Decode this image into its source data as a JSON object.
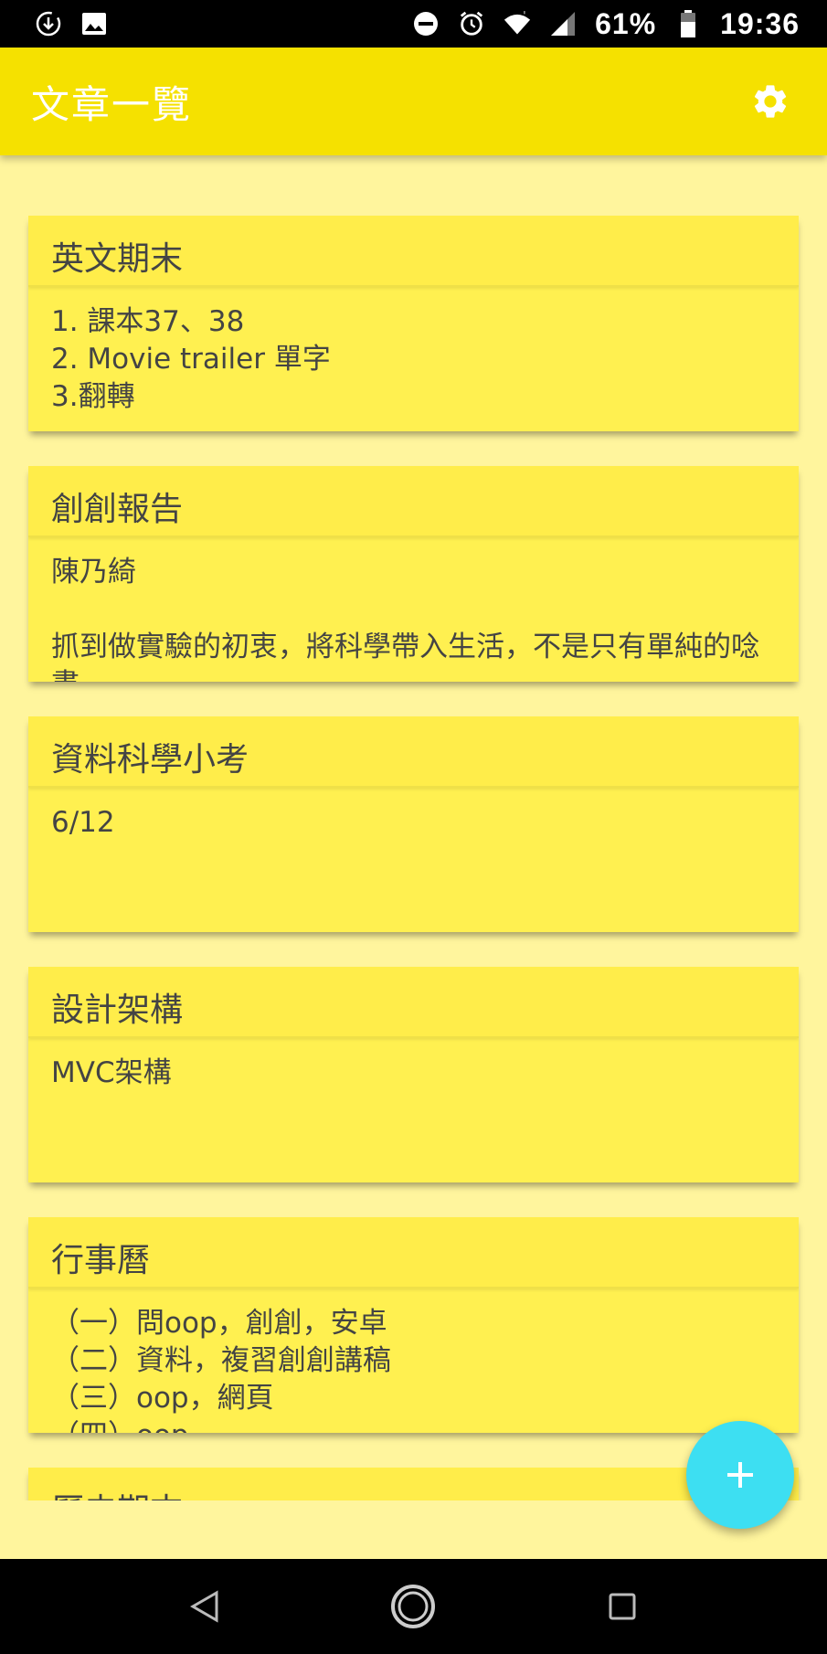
{
  "status_bar": {
    "battery_percent": "61%",
    "time": "19:36",
    "icons": [
      "download-icon",
      "image-icon",
      "dnd-icon",
      "alarm-icon",
      "wifi-icon",
      "signal-icon",
      "battery-icon"
    ]
  },
  "app_bar": {
    "title": "文章一覽",
    "settings_icon": "gear-icon"
  },
  "notes": [
    {
      "title": "英文期末",
      "body": "1. 課本37、38\n2. Movie trailer 單字\n3.翻轉"
    },
    {
      "title": "創創報告",
      "body": "陳乃綺\n\n抓到做實驗的初衷，將科學帶入生活，不是只有單純的唸書"
    },
    {
      "title": "資料科學小考",
      "body": "6/12"
    },
    {
      "title": "設計架構",
      "body": "MVC架構"
    },
    {
      "title": "行事曆",
      "body": "（一）問oop，創創，安卓\n（二）資料，複習創創講稿\n（三）oop，網頁\n（四）oop"
    },
    {
      "title": "歷史期末",
      "body": ""
    }
  ],
  "fab": {
    "icon": "plus-icon"
  },
  "nav_bar": {
    "icons": [
      "back-icon",
      "home-icon",
      "recents-icon"
    ]
  },
  "colors": {
    "app_bar": "#f5e100",
    "background": "#fff59d",
    "card": "#fff050",
    "fab": "#3ddff2"
  }
}
